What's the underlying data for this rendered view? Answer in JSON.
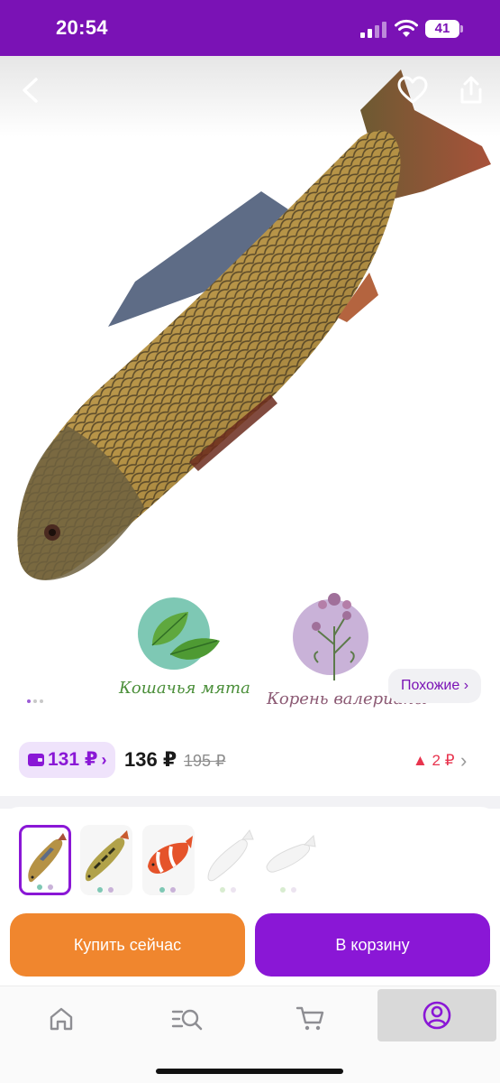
{
  "status_bar": {
    "time": "20:54",
    "battery_level": "41",
    "icons": [
      "signal-icon",
      "wifi-icon",
      "battery-icon"
    ],
    "background_color": "#7a12b5"
  },
  "header": {
    "icons": [
      "back-icon",
      "heart-icon",
      "share-icon"
    ]
  },
  "gallery": {
    "image_icon": "carp-fish-toy-image",
    "herbs": [
      {
        "label": "Кошачья мята",
        "icon": "catnip-leaf-icon"
      },
      {
        "label": "Корень валерианы",
        "icon": "valerian-flower-icon"
      }
    ],
    "dots_total": 3,
    "dots_active": 1,
    "similar_label": "Похожие ›"
  },
  "price": {
    "wallet_price": "131 ₽",
    "wallet_chevron": "›",
    "current_price": "136 ₽",
    "old_price": "195 ₽",
    "delta": "▲ 2 ₽",
    "chevron": "›",
    "accent_color": "#8a17d6",
    "delta_color": "#e8344e"
  },
  "variants": {
    "items": [
      {
        "name": "carp",
        "selected": true
      },
      {
        "name": "perch",
        "selected": false
      },
      {
        "name": "clownfish",
        "selected": false
      },
      {
        "name": "white-fish-1",
        "selected": false
      },
      {
        "name": "white-fish-2",
        "selected": false
      }
    ]
  },
  "actions": {
    "buy_now_label": "Купить сейчас",
    "add_to_cart_label": "В корзину",
    "buy_color": "#f0862e",
    "cart_color": "#8a17d6"
  },
  "bottom_nav": {
    "items": [
      {
        "icon": "home-icon",
        "active": false
      },
      {
        "icon": "catalog-search-icon",
        "active": false
      },
      {
        "icon": "cart-icon",
        "active": false
      },
      {
        "icon": "profile-icon",
        "active": true
      }
    ]
  }
}
